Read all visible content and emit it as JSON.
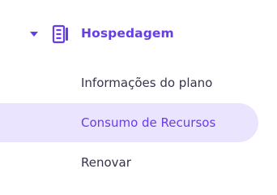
{
  "sidebar": {
    "section": {
      "title": "Hospedagem",
      "icon": "server-icon",
      "expanded": true,
      "accent_color": "#673de6"
    },
    "items": [
      {
        "label": "Informações do plano",
        "active": false
      },
      {
        "label": "Consumo de Recursos",
        "active": true
      },
      {
        "label": "Renovar",
        "active": false
      }
    ],
    "colors": {
      "active_background": "#ebe4ff",
      "text": "#36344d"
    }
  }
}
